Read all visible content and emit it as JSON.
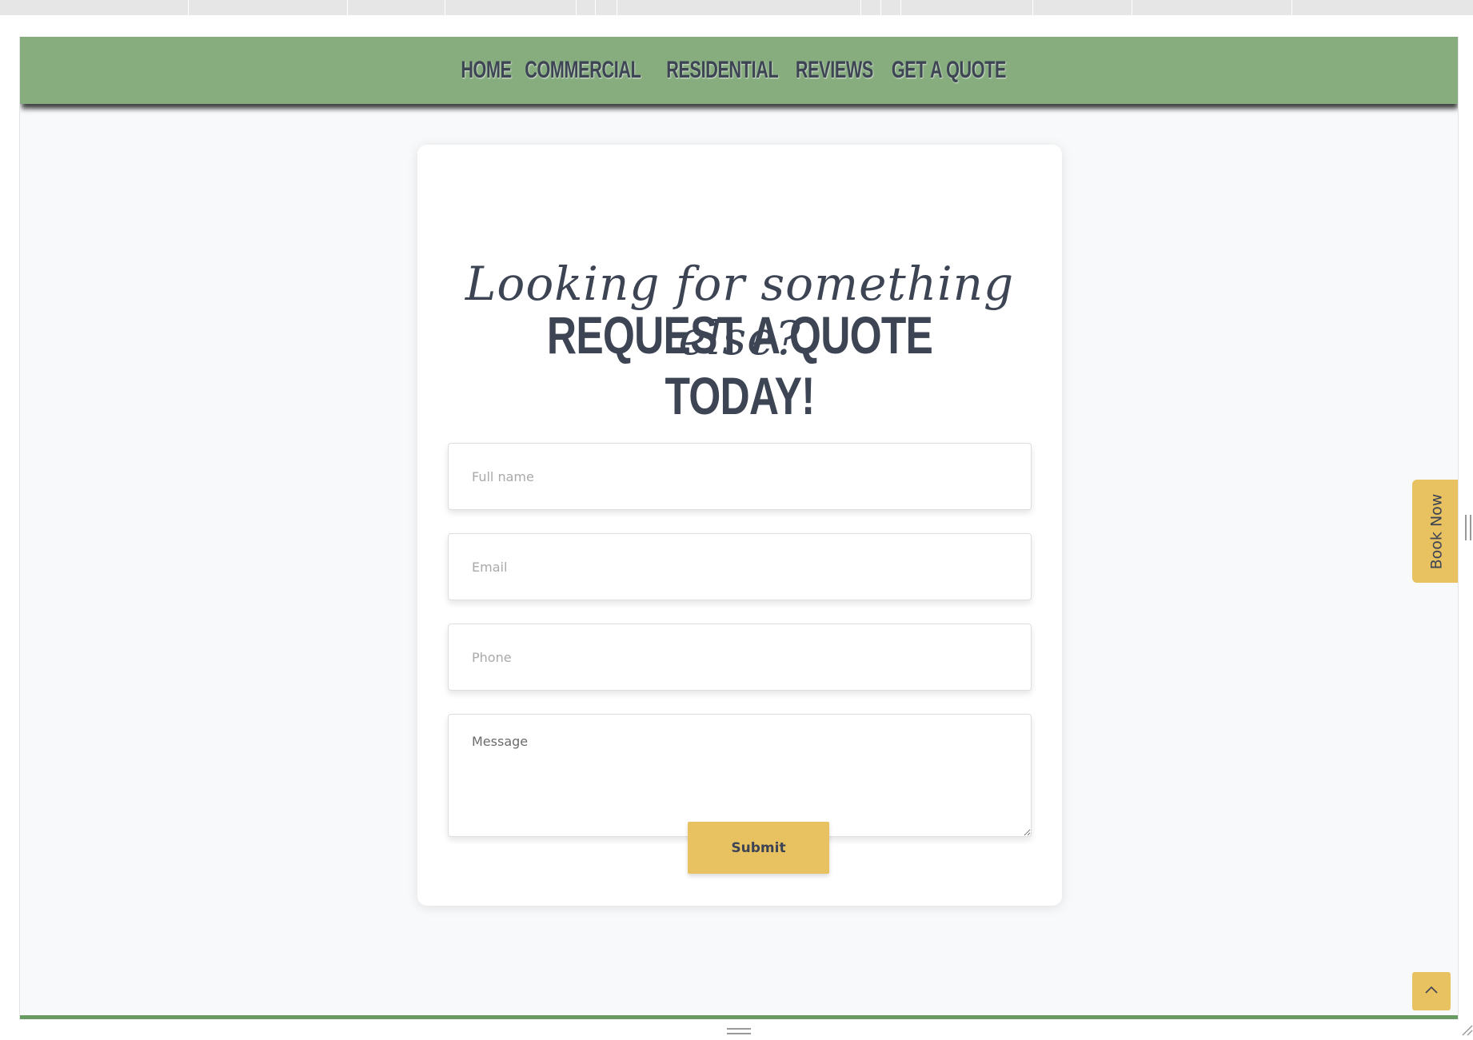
{
  "nav": {
    "items": [
      {
        "label": "HOME"
      },
      {
        "label": "COMMERCIAL"
      },
      {
        "label": "RESIDENTIAL"
      },
      {
        "label": "REVIEWS"
      },
      {
        "label": "GET A QUOTE"
      }
    ]
  },
  "form": {
    "script_heading": "Looking for something else?",
    "heading": "REQUEST A QUOTE TODAY!",
    "full_name_placeholder": "Full name",
    "email_placeholder": "Email",
    "phone_placeholder": "Phone",
    "message_placeholder": "Message",
    "submit_label": "Submit"
  },
  "sidebar": {
    "book_now_label": "Book Now"
  },
  "colors": {
    "nav_bg": "#87ad7f",
    "accent": "#e8c260",
    "text_dark": "#3d4454",
    "page_bg": "#f8f9fa"
  },
  "icons": {
    "scroll_top": "chevron-up-icon",
    "resize": "resize-corner-icon"
  }
}
